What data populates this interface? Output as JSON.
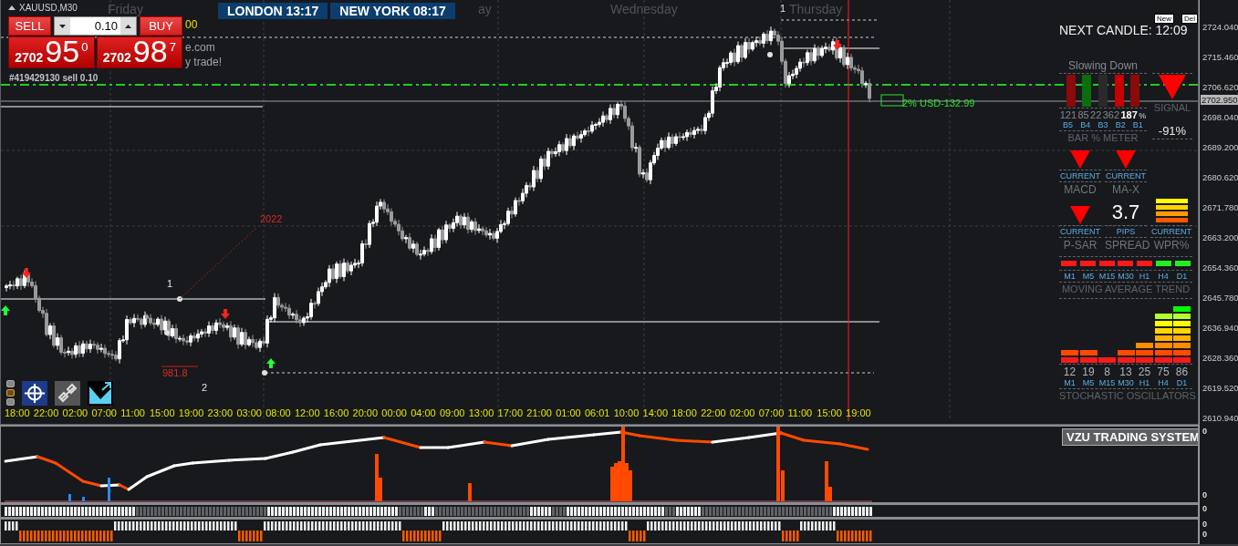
{
  "symbol": "XAUUSD,M30",
  "day_labels": [
    "Friday",
    "ay",
    "Wednesday",
    "Thursday"
  ],
  "clocks": [
    {
      "city": "LONDON",
      "time": "13:17"
    },
    {
      "city": "NEW YORK",
      "time": "08:17"
    }
  ],
  "trade_panel": {
    "sell_label": "SELL",
    "buy_label": "BUY",
    "lot": "0.10",
    "sell_price": {
      "prefix": "2702",
      "big": "95",
      "sup": "0"
    },
    "buy_price": {
      "prefix": "2702",
      "big": "98",
      "sup": "7"
    }
  },
  "partial_texts": [
    {
      "text": "00",
      "color": "#f0e000"
    },
    {
      "text": "e.com",
      "color": "#a0a4a8"
    },
    {
      "text": "y trade!",
      "color": "#a0a4a8"
    }
  ],
  "order_label": "#419429130 sell 0.10",
  "chart_labels": [
    {
      "text": "1",
      "kind": "wave"
    },
    {
      "text": "2",
      "kind": "wave"
    },
    {
      "text": "2022",
      "kind": "fibo"
    },
    {
      "text": "981.8",
      "kind": "fibo"
    },
    {
      "text": "1",
      "kind": "wave"
    },
    {
      "text": "2% USD-132.99",
      "kind": "profit"
    }
  ],
  "time_axis": [
    "18:00",
    "22:00",
    "02:00",
    "07:00",
    "11:00",
    "15:00",
    "19:00",
    "23:00",
    "03:00",
    "08:00",
    "12:00",
    "16:00",
    "20:00",
    "00:00",
    "04:00",
    "09:00",
    "13:00",
    "17:00",
    "21:00",
    "01:00",
    "06:01",
    "10:00",
    "14:00",
    "18:00",
    "22:00",
    "02:00",
    "07:00",
    "11:00",
    "15:00",
    "19:00"
  ],
  "price_axis": {
    "labels": [
      "2724.040",
      "2715.460",
      "2706.620",
      "2698.040",
      "2689.200",
      "2680.620",
      "2671.780",
      "2663.200",
      "2654.360",
      "2645.780",
      "2636.940",
      "2628.360",
      "2619.520",
      "2610.940"
    ],
    "current": "2702.950"
  },
  "dashboard": {
    "next_candle": "NEXT CANDLE: 12:09",
    "buttons": [
      "New",
      "Del"
    ],
    "bar_meter": {
      "title": "Slowing Down",
      "unit": "%",
      "caption": "BAR % METER",
      "bars": [
        {
          "value": "121",
          "label": "B5",
          "color": "#8b0a0a",
          "current": false
        },
        {
          "value": "85",
          "label": "B4",
          "color": "#0a6e0a",
          "current": false
        },
        {
          "value": "22",
          "label": "B3",
          "color": "#2a2a2a",
          "current": false
        },
        {
          "value": "362",
          "label": "B2",
          "color": "#c80000",
          "current": false
        },
        {
          "value": "187",
          "label": "B1",
          "color": "#8b0a0a",
          "current": true
        }
      ]
    },
    "signal": {
      "caption": "SIGNAL",
      "percent": "-91%"
    },
    "indicators": [
      {
        "kind": "arrow",
        "name": "MACD",
        "sub": "CURRENT"
      },
      {
        "kind": "arrow",
        "name": "MA-X",
        "sub": "CURRENT"
      },
      {
        "kind": "arrow",
        "name": "P-SAR",
        "sub": "CURRENT"
      },
      {
        "kind": "number",
        "name": "SPREAD",
        "sub": "PIPS",
        "value": "3.7"
      },
      {
        "kind": "bars",
        "name": "WPR%",
        "sub": "CURRENT"
      }
    ],
    "ma_trend": {
      "caption": "MOVING AVERAGE TREND",
      "frames": [
        {
          "label": "M1",
          "color": "#ff1a1a"
        },
        {
          "label": "M5",
          "color": "#ff1a1a"
        },
        {
          "label": "M15",
          "color": "#ff1a1a"
        },
        {
          "label": "M30",
          "color": "#ff1a1a"
        },
        {
          "label": "H1",
          "color": "#ff1a1a"
        },
        {
          "label": "H4",
          "color": "#22ee22"
        },
        {
          "label": "D1",
          "color": "#22ee22"
        }
      ]
    },
    "stochastic": {
      "caption": "STOCHASTIC OSCILLATORS",
      "frames": [
        {
          "label": "M1",
          "value": "12"
        },
        {
          "label": "M5",
          "value": "19"
        },
        {
          "label": "M15",
          "value": "8"
        },
        {
          "label": "M30",
          "value": "13"
        },
        {
          "label": "H1",
          "value": "25"
        },
        {
          "label": "H4",
          "value": "75"
        },
        {
          "label": "D1",
          "value": "86"
        }
      ]
    }
  },
  "indicator": {
    "title": "VZU TRADING SYSTEM",
    "scale_labels": [
      "0",
      "0"
    ]
  },
  "strip_scales": [
    [
      "0"
    ],
    [
      "0",
      "0"
    ]
  ]
}
